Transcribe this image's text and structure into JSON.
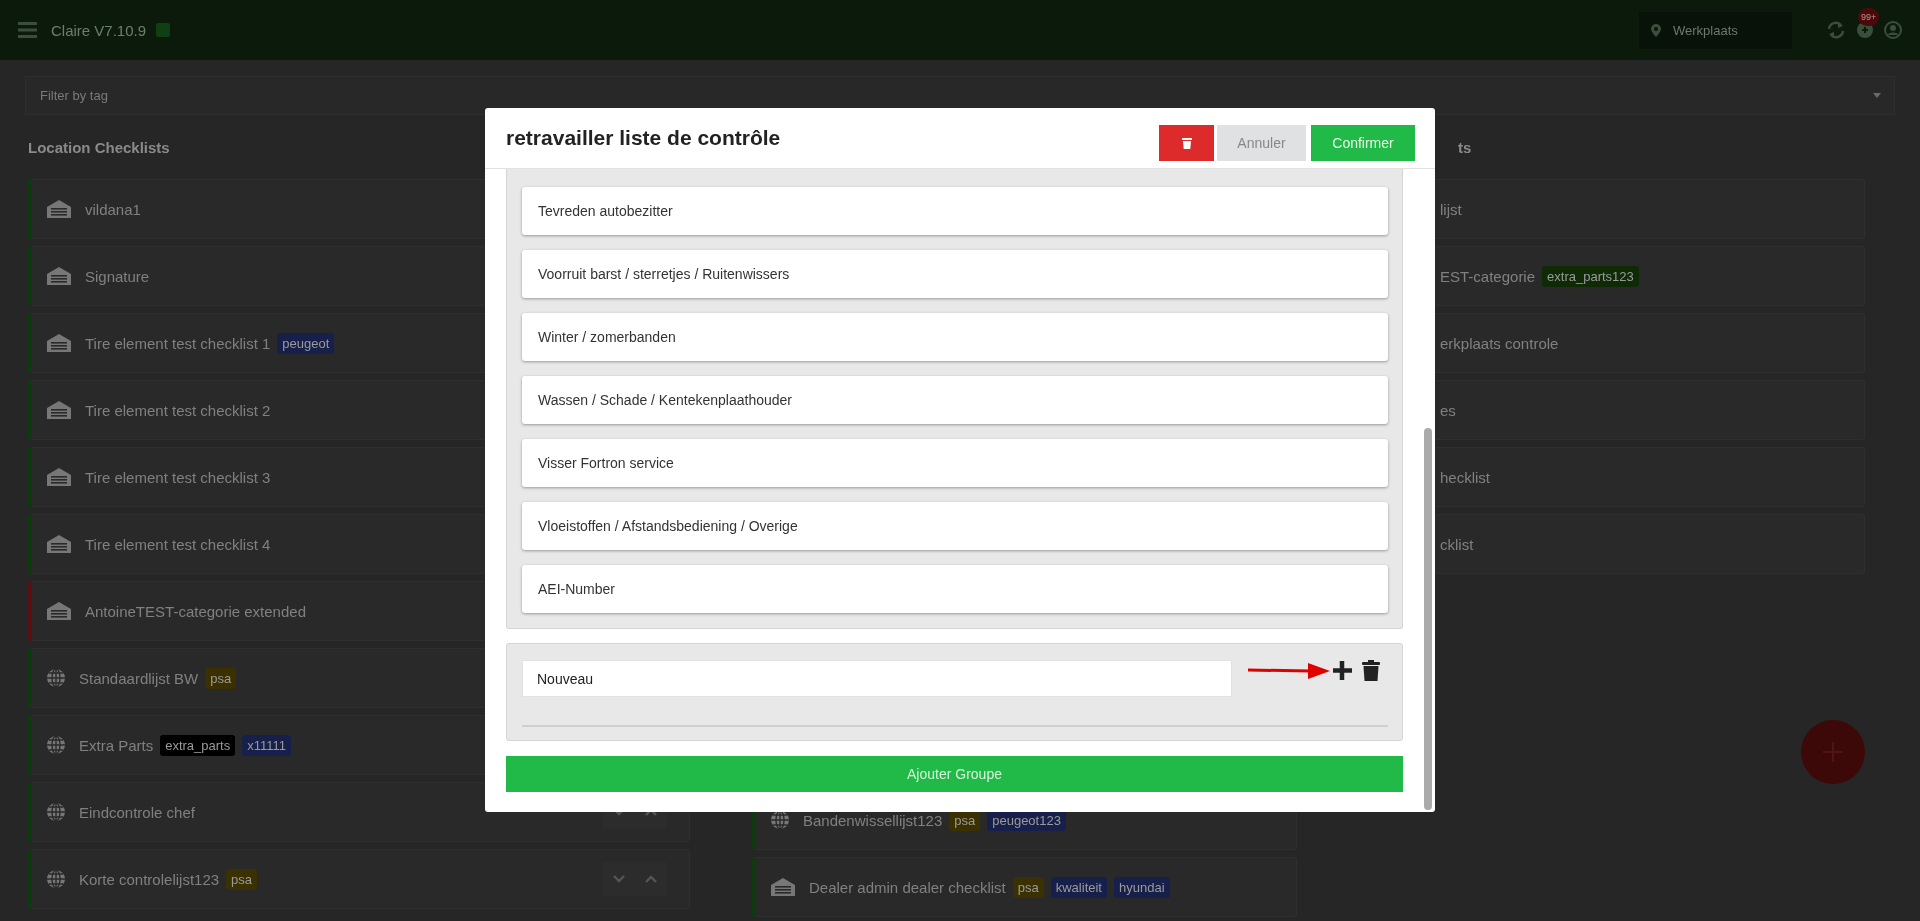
{
  "app_bar": {
    "title": "Claire V7.10.9",
    "location": "Werkplaats",
    "notification_count": "99+"
  },
  "filter": {
    "placeholder": "Filter by tag"
  },
  "left_column": {
    "heading": "Location Checklists",
    "items": [
      {
        "name": "vildana1",
        "kind": "location",
        "color": "#0d3b0d"
      },
      {
        "name": "Signature",
        "kind": "location",
        "color": "#0d3b0d"
      },
      {
        "name": "Tire element test checklist 1",
        "kind": "location",
        "color": "#0d3b0d",
        "tags": [
          {
            "label": "peugeot",
            "color": "#16204a"
          }
        ]
      },
      {
        "name": "Tire element test checklist 2",
        "kind": "location",
        "color": "#0d3b0d"
      },
      {
        "name": "Tire element test checklist 3",
        "kind": "location",
        "color": "#0d3b0d"
      },
      {
        "name": "Tire element test checklist 4",
        "kind": "location",
        "color": "#0d3b0d"
      },
      {
        "name": "AntoineTEST-categorie extended",
        "kind": "location",
        "color": "#5a1010"
      },
      {
        "name": "Standaardlijst BW",
        "kind": "global",
        "color": "#0d3b0d",
        "tags": [
          {
            "label": "psa",
            "color": "#3b3000"
          }
        ]
      },
      {
        "name": "Extra Parts",
        "kind": "global",
        "color": "#0d3b0d",
        "tags": [
          {
            "label": "extra_parts",
            "color": "#000000"
          },
          {
            "label": "x11111",
            "color": "#16204a"
          }
        ]
      },
      {
        "name": "Eindcontrole chef",
        "kind": "global",
        "color": "#0d3b0d",
        "sort_buttons": true
      },
      {
        "name": "Korte controlelijst123",
        "kind": "global",
        "color": "#0d3b0d",
        "tags": [
          {
            "label": "psa",
            "color": "#3b3000"
          }
        ],
        "sort_buttons": true
      }
    ]
  },
  "middle_column": {
    "items": [
      {
        "name": "Bandenwissellijst123",
        "kind": "global",
        "color": "#0d3b0d",
        "tags": [
          {
            "label": "psa",
            "color": "#3b3000"
          },
          {
            "label": "peugeot123",
            "color": "#16204a"
          }
        ]
      },
      {
        "name": "Dealer admin dealer checklist",
        "kind": "location",
        "color": "#0d3b0d",
        "tags": [
          {
            "label": "psa",
            "color": "#3b3000"
          },
          {
            "label": "kwaliteit",
            "color": "#16204a"
          },
          {
            "label": "hyundai",
            "color": "#16204a"
          }
        ]
      }
    ]
  },
  "right_column": {
    "heading": "ts",
    "items": [
      {
        "name": "lijst"
      },
      {
        "name": "EST-categorie",
        "tags": [
          {
            "label": "extra_parts123",
            "color": "#0e2b06"
          }
        ]
      },
      {
        "name": "erkplaats controle"
      },
      {
        "name": "es"
      },
      {
        "name": "hecklist"
      },
      {
        "name": "cklist"
      }
    ]
  },
  "modal": {
    "title": "retravailler liste de contrôle",
    "buttons": [
      {
        "kind": "delete"
      },
      {
        "kind": "cancel",
        "label": "Annuler"
      },
      {
        "kind": "confirm",
        "label": "Confirmer"
      }
    ],
    "items": [
      "Tevreden autobezitter",
      "Voorruit barst / sterretjes / Ruitenwissers",
      "Winter / zomerbanden",
      "Wassen / Schade / Kentekenplaathouder",
      "Visser Fortron service",
      "Vloeistoffen / Afstandsbediening / Overige",
      "AEI-Number"
    ],
    "new_item": {
      "value": "Nouveau"
    },
    "add_group_button": "Ajouter Groupe"
  }
}
